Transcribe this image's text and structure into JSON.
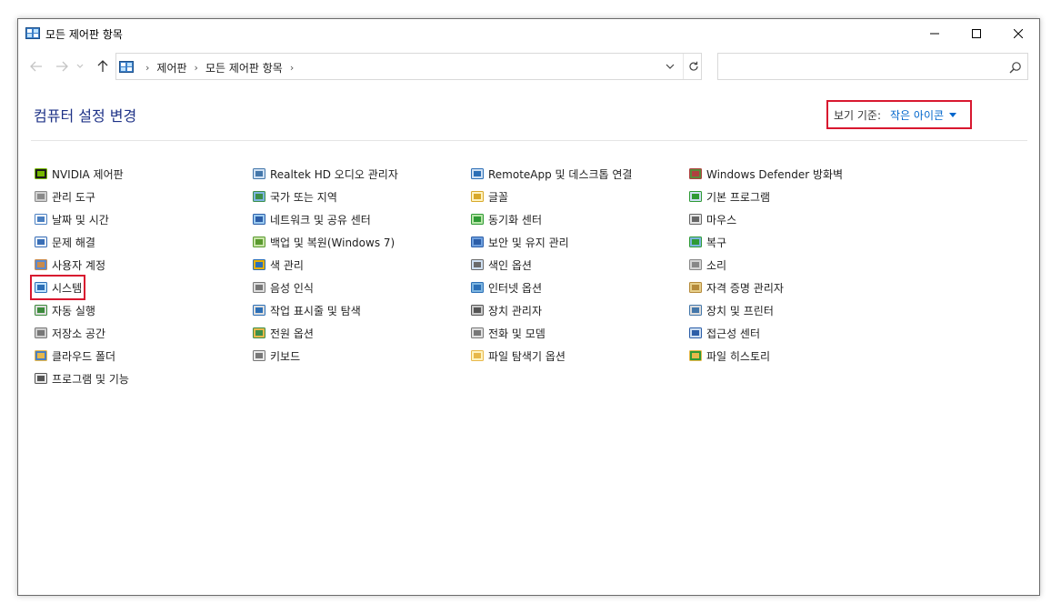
{
  "window": {
    "title": "모든 제어판 항목",
    "minimize_icon": "minimize-icon",
    "maximize_icon": "maximize-icon",
    "close_icon": "close-icon"
  },
  "address": {
    "crumbs": [
      "제어판",
      "모든 제어판 항목"
    ]
  },
  "search": {
    "placeholder": ""
  },
  "heading": "컴퓨터 설정 변경",
  "view_by": {
    "label": "보기 기준:",
    "value": "작은 아이콘"
  },
  "colors": {
    "accent": "#1e3287",
    "link": "#0066cc",
    "highlight_box": "#d8182f"
  },
  "columns": [
    [
      {
        "label": "NVIDIA 제어판",
        "icon": "nvidia-icon"
      },
      {
        "label": "관리 도구",
        "icon": "admin-tools-icon"
      },
      {
        "label": "날짜 및 시간",
        "icon": "clock-icon"
      },
      {
        "label": "문제 해결",
        "icon": "troubleshoot-icon"
      },
      {
        "label": "사용자 계정",
        "icon": "users-icon"
      },
      {
        "label": "시스템",
        "icon": "monitor-icon",
        "highlight": true
      },
      {
        "label": "자동 실행",
        "icon": "autoplay-icon"
      },
      {
        "label": "저장소 공간",
        "icon": "storage-icon"
      },
      {
        "label": "클라우드 폴더",
        "icon": "cloud-folder-icon"
      },
      {
        "label": "프로그램 및 기능",
        "icon": "programs-icon"
      }
    ],
    [
      {
        "label": "Realtek HD 오디오 관리자",
        "icon": "speaker-icon"
      },
      {
        "label": "국가 또는 지역",
        "icon": "globe-icon"
      },
      {
        "label": "네트워크 및 공유 센터",
        "icon": "network-icon"
      },
      {
        "label": "백업 및 복원(Windows 7)",
        "icon": "backup-icon"
      },
      {
        "label": "색 관리",
        "icon": "color-monitor-icon"
      },
      {
        "label": "음성 인식",
        "icon": "microphone-icon"
      },
      {
        "label": "작업 표시줄 및 탐색",
        "icon": "taskbar-icon"
      },
      {
        "label": "전원 옵션",
        "icon": "power-icon"
      },
      {
        "label": "키보드",
        "icon": "keyboard-icon"
      }
    ],
    [
      {
        "label": "RemoteApp 및 데스크톱 연결",
        "icon": "remote-desktop-icon"
      },
      {
        "label": "글꼴",
        "icon": "font-icon"
      },
      {
        "label": "동기화 센터",
        "icon": "sync-icon"
      },
      {
        "label": "보안 및 유지 관리",
        "icon": "flag-icon"
      },
      {
        "label": "색인 옵션",
        "icon": "search-index-icon"
      },
      {
        "label": "인터넷 옵션",
        "icon": "internet-icon"
      },
      {
        "label": "장치 관리자",
        "icon": "device-manager-icon"
      },
      {
        "label": "전화 및 모뎀",
        "icon": "phone-icon"
      },
      {
        "label": "파일 탐색기 옵션",
        "icon": "folder-options-icon"
      }
    ],
    [
      {
        "label": "Windows Defender 방화벽",
        "icon": "firewall-icon"
      },
      {
        "label": "기본 프로그램",
        "icon": "default-programs-icon"
      },
      {
        "label": "마우스",
        "icon": "mouse-icon"
      },
      {
        "label": "복구",
        "icon": "recovery-icon"
      },
      {
        "label": "소리",
        "icon": "sound-icon"
      },
      {
        "label": "자격 증명 관리자",
        "icon": "credential-icon"
      },
      {
        "label": "장치 및 프린터",
        "icon": "printer-icon"
      },
      {
        "label": "접근성 센터",
        "icon": "accessibility-icon"
      },
      {
        "label": "파일 히스토리",
        "icon": "file-history-icon"
      }
    ]
  ]
}
